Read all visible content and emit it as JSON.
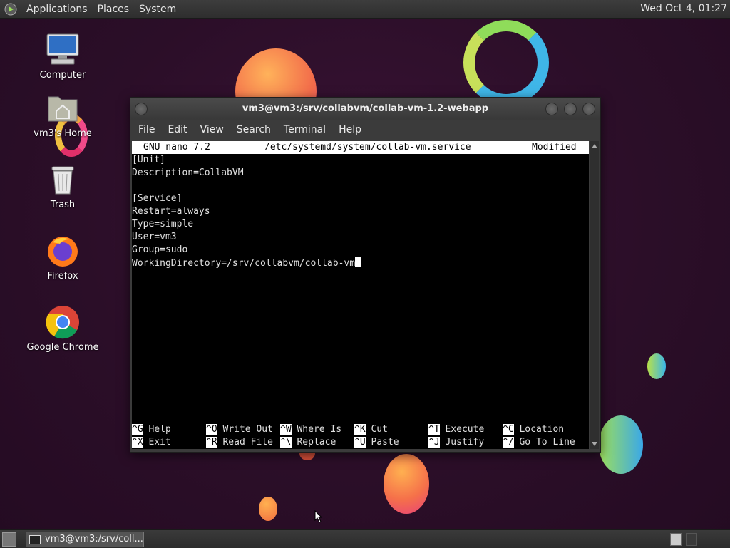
{
  "top_panel": {
    "menus": [
      "Applications",
      "Places",
      "System"
    ],
    "clock": "Wed Oct  4, 01:27"
  },
  "desktop_icons": [
    {
      "label": "Computer",
      "icon": "computer-icon"
    },
    {
      "label": "vm3's Home",
      "icon": "home-folder-icon"
    },
    {
      "label": "Trash",
      "icon": "trash-icon"
    },
    {
      "label": "Firefox",
      "icon": "firefox-icon"
    },
    {
      "label": "Google Chrome",
      "icon": "chrome-icon"
    }
  ],
  "window": {
    "title": "vm3@vm3:/srv/collabvm/collab-vm-1.2-webapp",
    "menubar": [
      "File",
      "Edit",
      "View",
      "Search",
      "Terminal",
      "Help"
    ]
  },
  "nano": {
    "version": "GNU nano 7.2",
    "filename": "/etc/systemd/system/collab-vm.service",
    "status": "Modified",
    "lines": [
      "[Unit]",
      "Description=CollabVM",
      "",
      "[Service]",
      "Restart=always",
      "Type=simple",
      "User=vm3",
      "Group=sudo",
      "WorkingDirectory=/srv/collabvm/collab-vm"
    ],
    "shortcuts_row1": [
      {
        "key": "^G",
        "label": "Help"
      },
      {
        "key": "^O",
        "label": "Write Out"
      },
      {
        "key": "^W",
        "label": "Where Is"
      },
      {
        "key": "^K",
        "label": "Cut"
      },
      {
        "key": "^T",
        "label": "Execute"
      },
      {
        "key": "^C",
        "label": "Location"
      }
    ],
    "shortcuts_row2": [
      {
        "key": "^X",
        "label": "Exit"
      },
      {
        "key": "^R",
        "label": "Read File"
      },
      {
        "key": "^\\",
        "label": "Replace"
      },
      {
        "key": "^U",
        "label": "Paste"
      },
      {
        "key": "^J",
        "label": "Justify"
      },
      {
        "key": "^/",
        "label": "Go To Line"
      }
    ]
  },
  "taskbar": {
    "task_label": "vm3@vm3:/srv/coll..."
  }
}
